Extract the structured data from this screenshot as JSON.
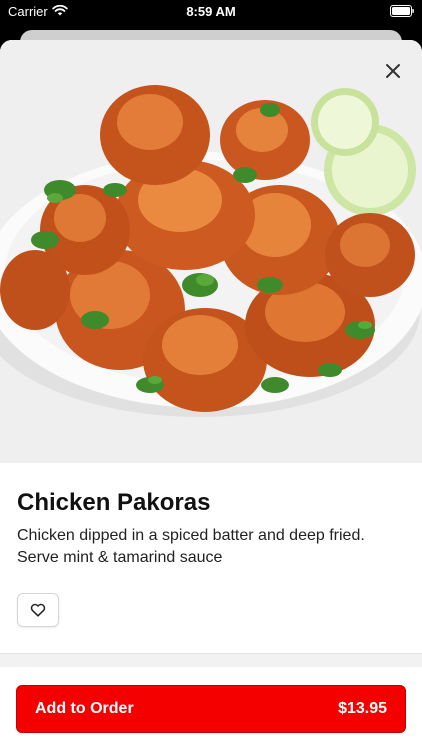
{
  "status_bar": {
    "carrier": "Carrier",
    "time": "8:59 AM",
    "wifi_icon": "wifi-icon",
    "battery_icon": "battery-icon"
  },
  "item": {
    "image_icon": "chicken-pakoras-photo",
    "title": "Chicken Pakoras",
    "description": "Chicken dipped in a spiced batter and deep fried. Serve mint & tamarind sauce"
  },
  "actions": {
    "close_icon": "close-icon",
    "favorite_icon": "heart-icon",
    "add_to_order_label": "Add to Order",
    "price": "$13.95"
  },
  "colors": {
    "accent": "#f50000",
    "text": "#111111"
  }
}
